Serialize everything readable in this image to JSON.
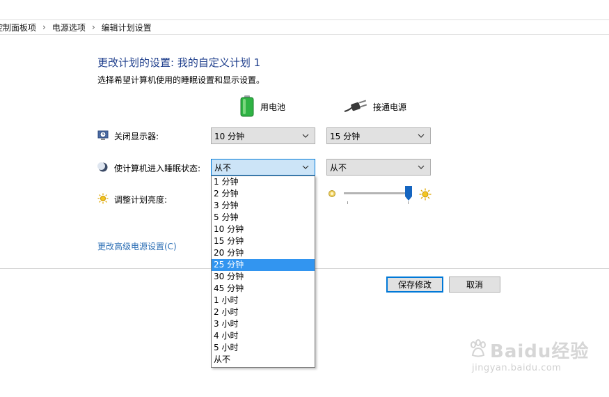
{
  "breadcrumb": {
    "items": [
      "控制面板项",
      "电源选项",
      "编辑计划设置"
    ],
    "separator": "›"
  },
  "header": {
    "title": "更改计划的设置: 我的自定义计划 1",
    "subtitle": "选择希望计算机使用的睡眠设置和显示设置。"
  },
  "columns": {
    "battery_label": "用电池",
    "plugged_label": "接通电源"
  },
  "rows": {
    "display_off_label": "关闭显示器:",
    "sleep_label": "使计算机进入睡眠状态:",
    "brightness_label": "调整计划亮度:"
  },
  "display_off": {
    "battery_value": "10 分钟",
    "plugged_value": "15 分钟"
  },
  "sleep": {
    "battery_value": "从不",
    "plugged_value": "从不"
  },
  "sleep_options": [
    "1 分钟",
    "2 分钟",
    "3 分钟",
    "5 分钟",
    "10 分钟",
    "15 分钟",
    "20 分钟",
    "25 分钟",
    "30 分钟",
    "45 分钟",
    "1 小时",
    "2 小时",
    "3 小时",
    "4 小时",
    "5 小时",
    "从不"
  ],
  "sleep_highlighted_option": "25 分钟",
  "brightness": {
    "plugged_level": 0.95
  },
  "advanced_link": "更改高级电源设置(C)",
  "buttons": {
    "save_label": "保存修改",
    "cancel_label": "取消"
  },
  "watermark": {
    "brand": "Baidu经验",
    "url": "jingyan.baidu.com"
  },
  "colors": {
    "heading": "#1e3e8c",
    "link": "#2d6fb5",
    "highlight": "#3295f0",
    "accent_border": "#0078d7"
  },
  "icons": [
    "battery-icon",
    "power-plug-icon",
    "display-clock-icon",
    "sleep-moon-icon",
    "brightness-sun-icon",
    "chevron-down-icon"
  ]
}
